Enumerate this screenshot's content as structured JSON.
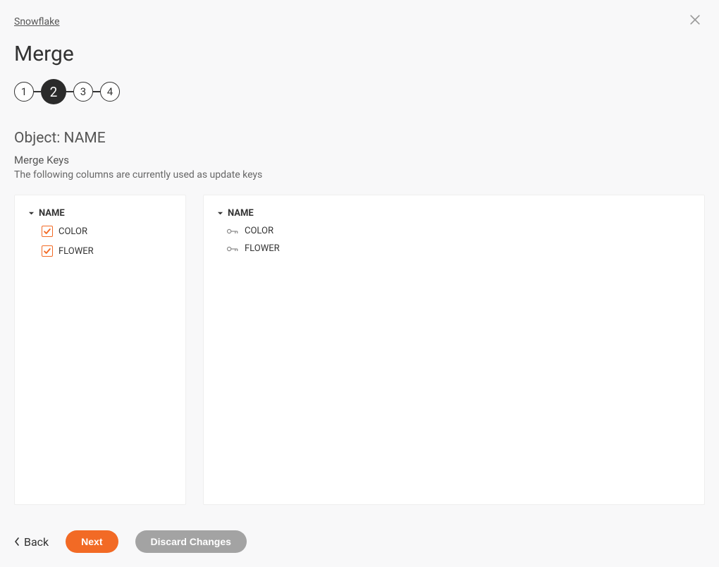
{
  "breadcrumb": "Snowflake",
  "title": "Merge",
  "stepper": {
    "steps": [
      "1",
      "2",
      "3",
      "4"
    ],
    "active_index": 1
  },
  "object_heading": "Object: NAME",
  "merge_keys_label": "Merge Keys",
  "merge_keys_desc": "The following columns are currently used as update keys",
  "left_panel": {
    "header": "NAME",
    "items": [
      {
        "label": "COLOR",
        "checked": true
      },
      {
        "label": "FLOWER",
        "checked": true
      }
    ]
  },
  "right_panel": {
    "header": "NAME",
    "items": [
      {
        "label": "COLOR"
      },
      {
        "label": "FLOWER"
      }
    ]
  },
  "buttons": {
    "back": "Back",
    "next": "Next",
    "discard": "Discard Changes"
  }
}
